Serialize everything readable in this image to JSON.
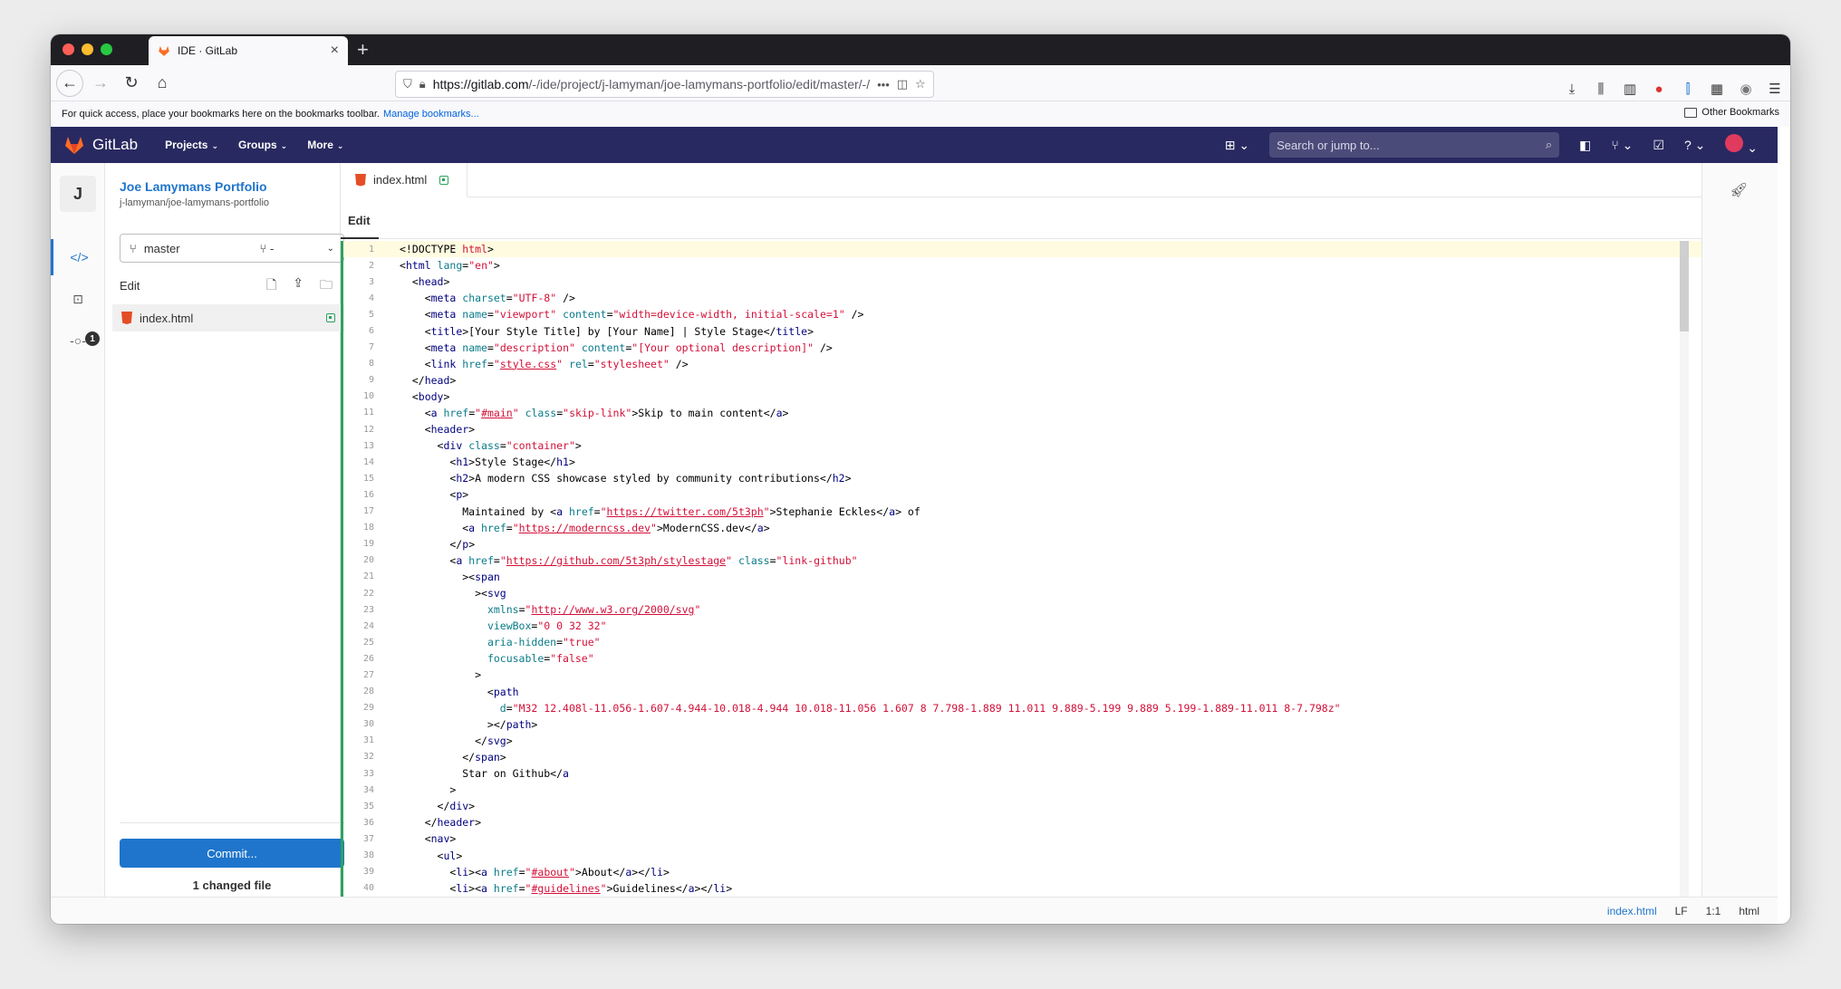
{
  "browser": {
    "tab_title": "IDE · GitLab",
    "url_host": "https://gitlab.com",
    "url_path": "/-/ide/project/j-lamyman/joe-lamymans-portfolio/edit/master/-/",
    "bookmarks_hint": "For quick access, place your bookmarks here on the bookmarks toolbar.",
    "manage_bookmarks": "Manage bookmarks...",
    "other_bookmarks": "Other Bookmarks"
  },
  "gitlab": {
    "brand": "GitLab",
    "menu": [
      "Projects",
      "Groups",
      "More"
    ],
    "search_placeholder": "Search or jump to..."
  },
  "sidebar": {
    "avatar_letter": "J",
    "project_name": "Joe Lamymans Portfolio",
    "project_path": "j-lamyman/joe-lamymans-portfolio",
    "branch": "master",
    "mr_label": "-",
    "edit_label": "Edit",
    "file": "index.html",
    "commit_label": "Commit...",
    "changed_files": "1 changed file",
    "commit_badge": "1"
  },
  "editor": {
    "tab_file": "index.html",
    "mode": "Edit"
  },
  "status": {
    "file": "index.html",
    "eol": "LF",
    "position": "1:1",
    "language": "html"
  },
  "colors": {
    "header": "#292961",
    "accent": "#1f75cb",
    "added": "#2da160"
  }
}
